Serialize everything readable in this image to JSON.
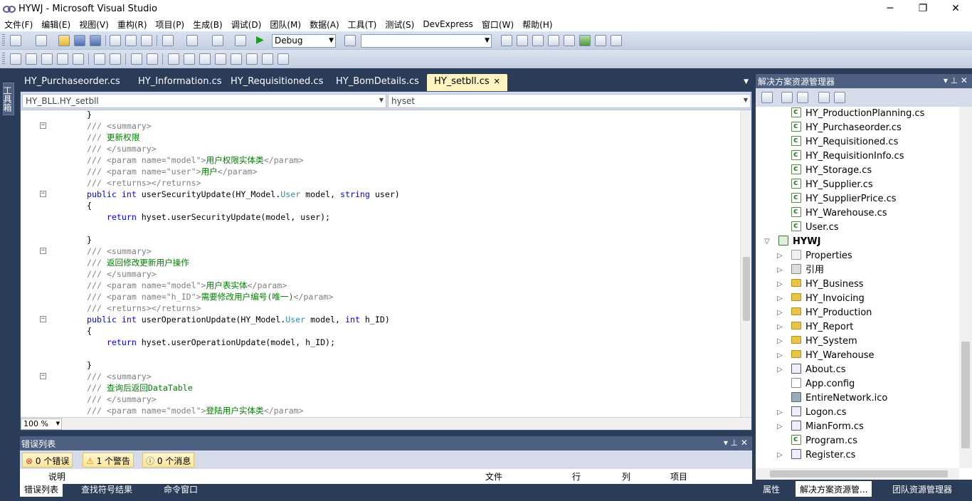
{
  "window": {
    "title": "HYWJ - Microsoft Visual Studio",
    "buttons": [
      "─",
      "❐",
      "✕"
    ]
  },
  "menu": [
    "文件(F)",
    "编辑(E)",
    "视图(V)",
    "重构(R)",
    "项目(P)",
    "生成(B)",
    "调试(D)",
    "团队(M)",
    "数据(A)",
    "工具(T)",
    "测试(S)",
    "DevExpress",
    "窗口(W)",
    "帮助(H)"
  ],
  "toolbar": {
    "config": "Debug",
    "find_value": ""
  },
  "toolbox_label": "工具箱",
  "tabs": [
    {
      "label": "HY_Purchaseorder.cs"
    },
    {
      "label": "HY_Information.cs"
    },
    {
      "label": "HY_Requisitioned.cs"
    },
    {
      "label": "HY_BomDetails.cs"
    },
    {
      "label": "HY_setbll.cs",
      "active": true
    }
  ],
  "nav": {
    "type": "HY_BLL.HY_setbll",
    "member": "hyset"
  },
  "code": [
    "        }",
    "        /// <summary>",
    "        /// 更新权限",
    "        /// </summary>",
    "        /// <param name=\"model\">用户权限实体类</param>",
    "        /// <param name=\"user\">用户</param>",
    "        /// <returns></returns>",
    "        public int userSecurityUpdate(HY_Model.User model, string user)",
    "        {",
    "            return hyset.userSecurityUpdate(model, user);",
    "",
    "        }",
    "        /// <summary>",
    "        /// 返回修改更新用户操作",
    "        /// </summary>",
    "        /// <param name=\"model\">用户表实体</param>",
    "        /// <param name=\"h_ID\">需要修改用户编号(唯一)</param>",
    "        /// <returns></returns>",
    "        public int userOperationUpdate(HY_Model.User model, int h_ID)",
    "        {",
    "            return hyset.userOperationUpdate(model, h_ID);",
    "",
    "        }",
    "        /// <summary>",
    "        /// 查询后返回DataTable",
    "        /// </summary>",
    "        /// <param name=\"model\">登陆用户实体类</param>"
  ],
  "zoom": "100 %",
  "errors": {
    "title": "错误列表",
    "errors_btn": "0 个错误",
    "warnings_btn": "1 个警告",
    "messages_btn": "0 个消息",
    "columns": [
      "说明",
      "文件",
      "行",
      "列",
      "项目"
    ]
  },
  "bottom_tabs": [
    "错误列表",
    "查找符号结果",
    "命令窗口"
  ],
  "solution": {
    "title": "解决方案资源管理器",
    "items": [
      {
        "label": "HY_ProductionPlanning.cs",
        "icon": "cs"
      },
      {
        "label": "HY_Purchaseorder.cs",
        "icon": "cs"
      },
      {
        "label": "HY_Requisitioned.cs",
        "icon": "cs"
      },
      {
        "label": "HY_RequisitionInfo.cs",
        "icon": "cs"
      },
      {
        "label": "HY_Storage.cs",
        "icon": "cs"
      },
      {
        "label": "HY_Supplier.cs",
        "icon": "cs"
      },
      {
        "label": "HY_SupplierPrice.cs",
        "icon": "cs"
      },
      {
        "label": "HY_Warehouse.cs",
        "icon": "cs"
      },
      {
        "label": "User.cs",
        "icon": "cs"
      },
      {
        "label": "HYWJ",
        "icon": "proj"
      },
      {
        "label": "Properties",
        "icon": "prop"
      },
      {
        "label": "引用",
        "icon": "ref"
      },
      {
        "label": "HY_Business",
        "icon": "folder"
      },
      {
        "label": "HY_Invoicing",
        "icon": "folder"
      },
      {
        "label": "HY_Production",
        "icon": "folder"
      },
      {
        "label": "HY_Report",
        "icon": "folder"
      },
      {
        "label": "HY_System",
        "icon": "folder"
      },
      {
        "label": "HY_Warehouse",
        "icon": "folder"
      },
      {
        "label": "About.cs",
        "icon": "form"
      },
      {
        "label": "App.config",
        "icon": "cfg"
      },
      {
        "label": "EntireNetwork.ico",
        "icon": "ico"
      },
      {
        "label": "Logon.cs",
        "icon": "form"
      },
      {
        "label": "MianForm.cs",
        "icon": "form"
      },
      {
        "label": "Program.cs",
        "icon": "cs"
      },
      {
        "label": "Register.cs",
        "icon": "form"
      }
    ]
  },
  "solution_bottom_tabs": [
    "属性",
    "解决方案资源管...",
    "团队资源管理器"
  ]
}
